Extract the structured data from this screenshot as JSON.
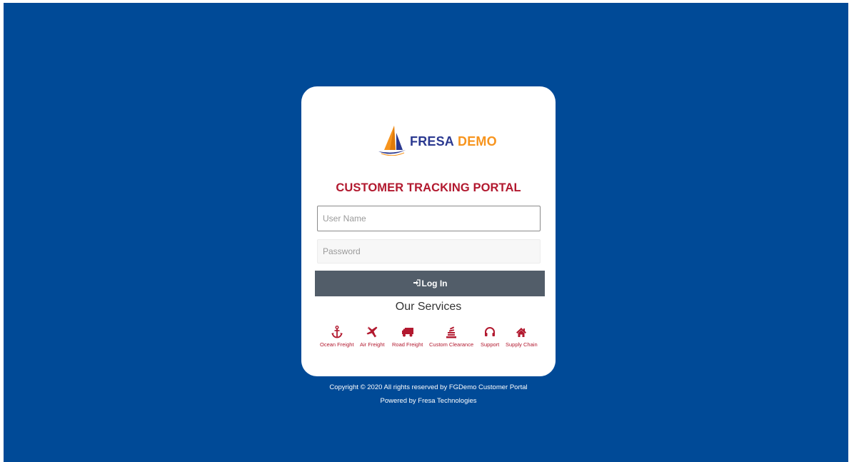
{
  "brand": {
    "name_part1": "FRESA",
    "name_part2": "DEMO",
    "colors": {
      "background": "#004a97",
      "accent_red": "#b2192f",
      "logo_blue": "#2b3990",
      "logo_orange": "#f7941d",
      "button": "#525d69"
    }
  },
  "login": {
    "title": "CUSTOMER TRACKING PORTAL",
    "username_placeholder": "User Name",
    "username_value": "",
    "password_placeholder": "Password",
    "password_value": "",
    "button_label": "Log In",
    "button_icon": "sign-in-icon"
  },
  "services": {
    "title": "Our Services",
    "items": [
      {
        "label": "Ocean Freight",
        "icon": "anchor-icon"
      },
      {
        "label": "Air Freight",
        "icon": "plane-icon"
      },
      {
        "label": "Road Freight",
        "icon": "truck-icon"
      },
      {
        "label": "Custom Clearance",
        "icon": "stack-icon"
      },
      {
        "label": "Support",
        "icon": "headset-icon"
      },
      {
        "label": "Supply Chain",
        "icon": "home-icon"
      }
    ]
  },
  "footer": {
    "copyright": "Copyright © 2020 All rights reserved by FGDemo Customer Portal",
    "powered_by": "Powered by Fresa Technologies"
  }
}
